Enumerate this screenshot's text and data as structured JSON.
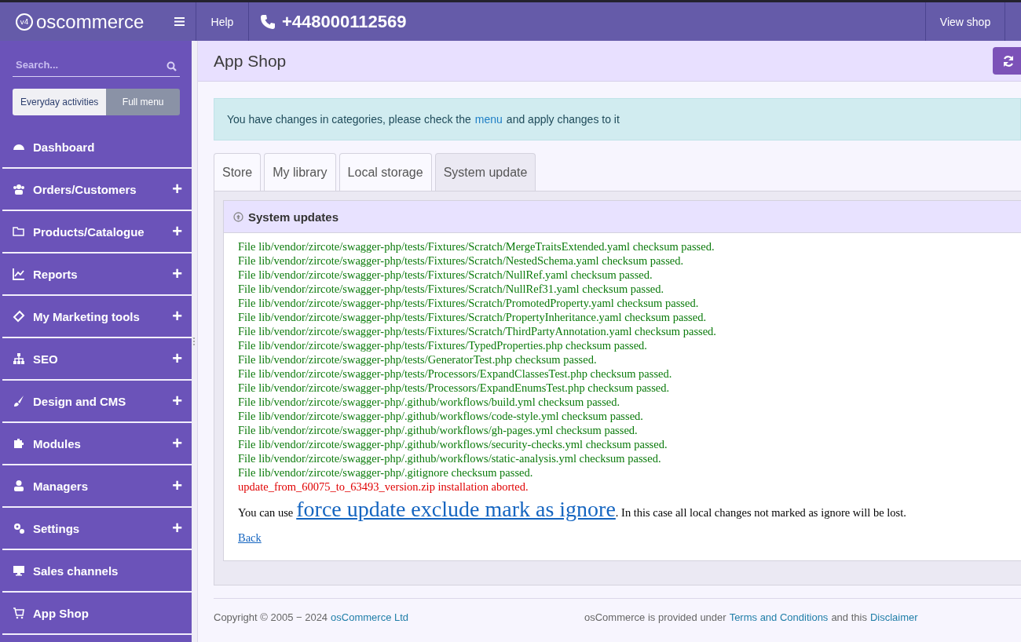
{
  "header": {
    "logo": "oscommerce",
    "logo_badge": "v4",
    "help": "Help",
    "phone": "+448000112569",
    "view_shop": "View shop"
  },
  "sidebar": {
    "search": {
      "placeholder": "Search..."
    },
    "modes": [
      {
        "label": "Everyday activities",
        "selected": false
      },
      {
        "label": "Full menu",
        "selected": true
      }
    ],
    "items": [
      {
        "label": "Dashboard",
        "expandable": false
      },
      {
        "label": "Orders/Customers",
        "expandable": true
      },
      {
        "label": "Products/Catalogue",
        "expandable": true
      },
      {
        "label": "Reports",
        "expandable": true
      },
      {
        "label": "My Marketing tools",
        "expandable": true
      },
      {
        "label": "SEO",
        "expandable": true
      },
      {
        "label": "Design and CMS",
        "expandable": true
      },
      {
        "label": "Modules",
        "expandable": true
      },
      {
        "label": "Managers",
        "expandable": true
      },
      {
        "label": "Settings",
        "expandable": true
      },
      {
        "label": "Sales channels",
        "expandable": false
      },
      {
        "label": "App Shop",
        "expandable": false
      }
    ],
    "expand_sign": "+"
  },
  "page": {
    "title": "App Shop"
  },
  "alert": {
    "before": "You have changes in categories, please check the",
    "link": "menu",
    "after": "and apply changes to it"
  },
  "tabs": [
    {
      "label": "Store",
      "selected": false
    },
    {
      "label": "My library",
      "selected": false
    },
    {
      "label": "Local storage",
      "selected": false
    },
    {
      "label": "System update",
      "selected": true
    }
  ],
  "panel": {
    "title": "System updates",
    "log": [
      {
        "kind": "ok",
        "text": "File lib/vendor/zircote/swagger-php/tests/Fixtures/Scratch/MergeTraitsExtended.yaml checksum passed."
      },
      {
        "kind": "ok",
        "text": "File lib/vendor/zircote/swagger-php/tests/Fixtures/Scratch/NestedSchema.yaml checksum passed."
      },
      {
        "kind": "ok",
        "text": "File lib/vendor/zircote/swagger-php/tests/Fixtures/Scratch/NullRef.yaml checksum passed."
      },
      {
        "kind": "ok",
        "text": "File lib/vendor/zircote/swagger-php/tests/Fixtures/Scratch/NullRef31.yaml checksum passed."
      },
      {
        "kind": "ok",
        "text": "File lib/vendor/zircote/swagger-php/tests/Fixtures/Scratch/PromotedProperty.yaml checksum passed."
      },
      {
        "kind": "ok",
        "text": "File lib/vendor/zircote/swagger-php/tests/Fixtures/Scratch/PropertyInheritance.yaml checksum passed."
      },
      {
        "kind": "ok",
        "text": "File lib/vendor/zircote/swagger-php/tests/Fixtures/Scratch/ThirdPartyAnnotation.yaml checksum passed."
      },
      {
        "kind": "ok",
        "text": "File lib/vendor/zircote/swagger-php/tests/Fixtures/TypedProperties.php checksum passed."
      },
      {
        "kind": "ok",
        "text": "File lib/vendor/zircote/swagger-php/tests/GeneratorTest.php checksum passed."
      },
      {
        "kind": "ok",
        "text": "File lib/vendor/zircote/swagger-php/tests/Processors/ExpandClassesTest.php checksum passed."
      },
      {
        "kind": "ok",
        "text": "File lib/vendor/zircote/swagger-php/tests/Processors/ExpandEnumsTest.php checksum passed."
      },
      {
        "kind": "ok",
        "text": "File lib/vendor/zircote/swagger-php/.github/workflows/build.yml checksum passed."
      },
      {
        "kind": "ok",
        "text": "File lib/vendor/zircote/swagger-php/.github/workflows/code-style.yml checksum passed."
      },
      {
        "kind": "ok",
        "text": "File lib/vendor/zircote/swagger-php/.github/workflows/gh-pages.yml checksum passed."
      },
      {
        "kind": "ok",
        "text": "File lib/vendor/zircote/swagger-php/.github/workflows/security-checks.yml checksum passed."
      },
      {
        "kind": "ok",
        "text": "File lib/vendor/zircote/swagger-php/.github/workflows/static-analysis.yml checksum passed."
      },
      {
        "kind": "ok",
        "text": "File lib/vendor/zircote/swagger-php/.gitignore checksum passed."
      },
      {
        "kind": "error",
        "text": "update_from_60075_to_63493_version.zip installation aborted."
      }
    ],
    "notice": {
      "before": "You can use",
      "link": "force update exclude mark as ignore",
      "after": ". In this case all local changes not marked as ignore will be lost."
    },
    "back": "Back"
  },
  "footer": {
    "copyright": "Copyright © 2005 − 2024",
    "company": "osCommerce Ltd",
    "provided": "osCommerce is provided under",
    "terms": "Terms and Conditions",
    "and": "and this",
    "disclaimer": "Disclaimer"
  }
}
